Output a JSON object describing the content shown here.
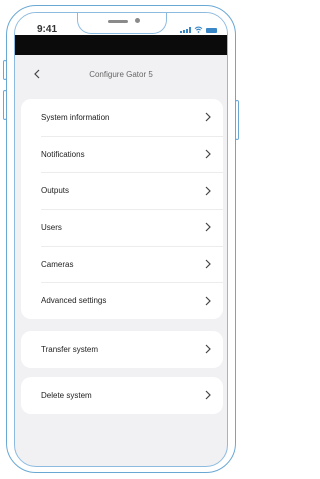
{
  "status_bar": {
    "time": "9:41"
  },
  "nav": {
    "title": "Configure Gator 5",
    "back_glyph": "<"
  },
  "menu_main": [
    {
      "label": "System information"
    },
    {
      "label": "Notifications"
    },
    {
      "label": "Outputs"
    },
    {
      "label": "Users"
    },
    {
      "label": "Cameras"
    },
    {
      "label": "Advanced settings"
    }
  ],
  "menu_transfer": {
    "label": "Transfer system"
  },
  "menu_delete": {
    "label": "Delete system"
  },
  "icons": {
    "back": "chevron-left-icon",
    "row": "chevron-right-icon",
    "signal": "signal-icon",
    "wifi": "wifi-icon",
    "battery": "battery-icon"
  },
  "colors": {
    "accent": "#3a87c8",
    "screen_bg": "#f1f1f3",
    "card_bg": "#ffffff",
    "frame": "#6aa8d4"
  }
}
